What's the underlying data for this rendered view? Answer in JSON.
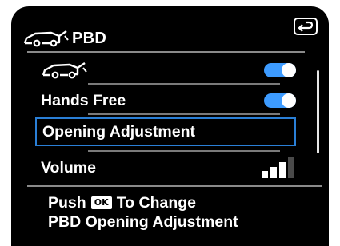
{
  "header": {
    "title": "PBD",
    "car_icon": "car-open-tailgate-icon",
    "back_icon": "return-arrow-icon"
  },
  "menu": {
    "items": [
      {
        "label": "",
        "icon": "car-open-tailgate-icon",
        "control": "toggle",
        "state": "on"
      },
      {
        "label": "Hands Free",
        "control": "toggle",
        "state": "on"
      },
      {
        "label": "Opening Adjustment",
        "control": "none",
        "selected": true
      },
      {
        "label": "Volume",
        "control": "level",
        "level": 0.75
      }
    ]
  },
  "footer": {
    "push": "Push",
    "ok": "OK",
    "to_change": "To Change",
    "line2": "PBD Opening Adjustment"
  },
  "colors": {
    "background": "#000000",
    "toggle_on": "#3d9bff",
    "selection_border": "#2a7fd6",
    "text": "#ffffff"
  }
}
